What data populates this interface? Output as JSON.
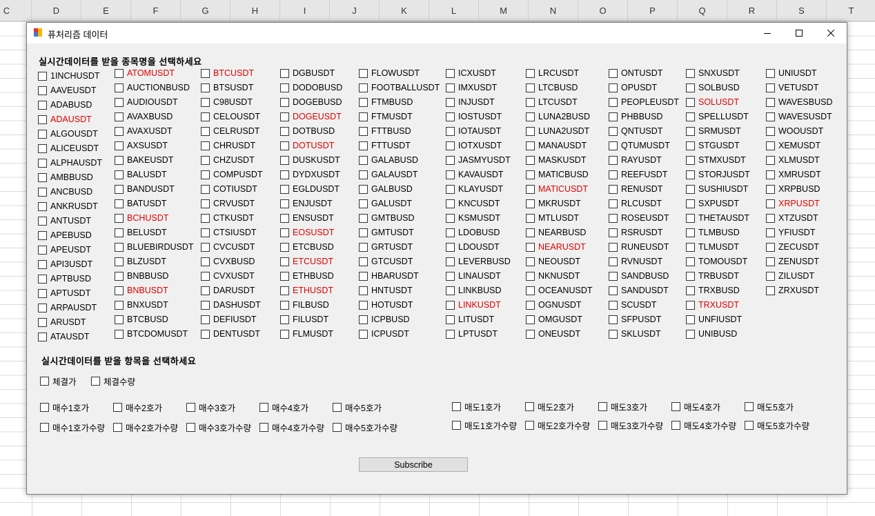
{
  "spreadsheet": {
    "columns": [
      "C",
      "D",
      "E",
      "F",
      "G",
      "H",
      "I",
      "J",
      "K",
      "L",
      "M",
      "N",
      "O",
      "P",
      "Q",
      "R",
      "S",
      "T"
    ]
  },
  "window": {
    "title": "퓨처리즘 데이터",
    "minimize_icon": "minimize-icon",
    "maximize_icon": "maximize-icon",
    "close_icon": "close-icon"
  },
  "symbols_heading": "실시간데이터를 받을 종목명을 선택하세요",
  "symbol_columns": [
    [
      {
        "label": "1INCHUSDT"
      },
      {
        "label": "AAVEUSDT"
      },
      {
        "label": "ADABUSD"
      },
      {
        "label": "ADAUSDT",
        "highlight": true
      },
      {
        "label": "ALGOUSDT"
      },
      {
        "label": "ALICEUSDT"
      },
      {
        "label": "ALPHAUSDT"
      },
      {
        "label": "AMBBUSD"
      },
      {
        "label": "ANCBUSD"
      },
      {
        "label": "ANKRUSDT"
      },
      {
        "label": "ANTUSDT"
      },
      {
        "label": "APEBUSD"
      },
      {
        "label": "APEUSDT"
      },
      {
        "label": "API3USDT"
      },
      {
        "label": "APTBUSD"
      },
      {
        "label": "APTUSDT"
      },
      {
        "label": "ARPAUSDT"
      },
      {
        "label": "ARUSDT"
      },
      {
        "label": "ATAUSDT"
      }
    ],
    [
      {
        "label": "ATOMUSDT",
        "highlight": true
      },
      {
        "label": "AUCTIONBUSD"
      },
      {
        "label": "AUDIOUSDT"
      },
      {
        "label": "AVAXBUSD"
      },
      {
        "label": "AVAXUSDT"
      },
      {
        "label": "AXSUSDT"
      },
      {
        "label": "BAKEUSDT"
      },
      {
        "label": "BALUSDT"
      },
      {
        "label": "BANDUSDT"
      },
      {
        "label": "BATUSDT"
      },
      {
        "label": "BCHUSDT",
        "highlight": true
      },
      {
        "label": "BELUSDT"
      },
      {
        "label": "BLUEBIRDUSDT"
      },
      {
        "label": "BLZUSDT"
      },
      {
        "label": "BNBBUSD"
      },
      {
        "label": "BNBUSDT",
        "highlight": true
      },
      {
        "label": "BNXUSDT"
      },
      {
        "label": "BTCBUSD"
      },
      {
        "label": "BTCDOMUSDT"
      }
    ],
    [
      {
        "label": "BTCUSDT",
        "highlight": true
      },
      {
        "label": "BTSUSDT"
      },
      {
        "label": "C98USDT"
      },
      {
        "label": "CELOUSDT"
      },
      {
        "label": "CELRUSDT"
      },
      {
        "label": "CHRUSDT"
      },
      {
        "label": "CHZUSDT"
      },
      {
        "label": "COMPUSDT"
      },
      {
        "label": "COTIUSDT"
      },
      {
        "label": "CRVUSDT"
      },
      {
        "label": "CTKUSDT"
      },
      {
        "label": "CTSIUSDT"
      },
      {
        "label": "CVCUSDT"
      },
      {
        "label": "CVXBUSD"
      },
      {
        "label": "CVXUSDT"
      },
      {
        "label": "DARUSDT"
      },
      {
        "label": "DASHUSDT"
      },
      {
        "label": "DEFIUSDT"
      },
      {
        "label": "DENTUSDT"
      }
    ],
    [
      {
        "label": "DGBUSDT"
      },
      {
        "label": "DODOBUSD"
      },
      {
        "label": "DOGEBUSD"
      },
      {
        "label": "DOGEUSDT",
        "highlight": true
      },
      {
        "label": "DOTBUSD"
      },
      {
        "label": "DOTUSDT",
        "highlight": true
      },
      {
        "label": "DUSKUSDT"
      },
      {
        "label": "DYDXUSDT"
      },
      {
        "label": "EGLDUSDT"
      },
      {
        "label": "ENJUSDT"
      },
      {
        "label": "ENSUSDT"
      },
      {
        "label": "EOSUSDT",
        "highlight": true
      },
      {
        "label": "ETCBUSD"
      },
      {
        "label": "ETCUSDT",
        "highlight": true
      },
      {
        "label": "ETHBUSD"
      },
      {
        "label": "ETHUSDT",
        "highlight": true
      },
      {
        "label": "FILBUSD"
      },
      {
        "label": "FILUSDT"
      },
      {
        "label": "FLMUSDT"
      }
    ],
    [
      {
        "label": "FLOWUSDT"
      },
      {
        "label": "FOOTBALLUSDT"
      },
      {
        "label": "FTMBUSD"
      },
      {
        "label": "FTMUSDT"
      },
      {
        "label": "FTTBUSD"
      },
      {
        "label": "FTTUSDT"
      },
      {
        "label": "GALABUSD"
      },
      {
        "label": "GALAUSDT"
      },
      {
        "label": "GALBUSD"
      },
      {
        "label": "GALUSDT"
      },
      {
        "label": "GMTBUSD"
      },
      {
        "label": "GMTUSDT"
      },
      {
        "label": "GRTUSDT"
      },
      {
        "label": "GTCUSDT"
      },
      {
        "label": "HBARUSDT"
      },
      {
        "label": "HNTUSDT"
      },
      {
        "label": "HOTUSDT"
      },
      {
        "label": "ICPBUSD"
      },
      {
        "label": "ICPUSDT"
      }
    ],
    [
      {
        "label": "ICXUSDT"
      },
      {
        "label": "IMXUSDT"
      },
      {
        "label": "INJUSDT"
      },
      {
        "label": "IOSTUSDT"
      },
      {
        "label": "IOTAUSDT"
      },
      {
        "label": "IOTXUSDT"
      },
      {
        "label": "JASMYUSDT"
      },
      {
        "label": "KAVAUSDT"
      },
      {
        "label": "KLAYUSDT"
      },
      {
        "label": "KNCUSDT"
      },
      {
        "label": "KSMUSDT"
      },
      {
        "label": "LDOBUSD"
      },
      {
        "label": "LDOUSDT"
      },
      {
        "label": "LEVERBUSD"
      },
      {
        "label": "LINAUSDT"
      },
      {
        "label": "LINKBUSD"
      },
      {
        "label": "LINKUSDT",
        "highlight": true
      },
      {
        "label": "LITUSDT"
      },
      {
        "label": "LPTUSDT"
      }
    ],
    [
      {
        "label": "LRCUSDT"
      },
      {
        "label": "LTCBUSD"
      },
      {
        "label": "LTCUSDT"
      },
      {
        "label": "LUNA2BUSD"
      },
      {
        "label": "LUNA2USDT"
      },
      {
        "label": "MANAUSDT"
      },
      {
        "label": "MASKUSDT"
      },
      {
        "label": "MATICBUSD"
      },
      {
        "label": "MATICUSDT",
        "highlight": true
      },
      {
        "label": "MKRUSDT"
      },
      {
        "label": "MTLUSDT"
      },
      {
        "label": "NEARBUSD"
      },
      {
        "label": "NEARUSDT",
        "highlight": true
      },
      {
        "label": "NEOUSDT"
      },
      {
        "label": "NKNUSDT"
      },
      {
        "label": "OCEANUSDT"
      },
      {
        "label": "OGNUSDT"
      },
      {
        "label": "OMGUSDT"
      },
      {
        "label": "ONEUSDT"
      }
    ],
    [
      {
        "label": "ONTUSDT"
      },
      {
        "label": "OPUSDT"
      },
      {
        "label": "PEOPLEUSDT"
      },
      {
        "label": "PHBBUSD"
      },
      {
        "label": "QNTUSDT"
      },
      {
        "label": "QTUMUSDT"
      },
      {
        "label": "RAYUSDT"
      },
      {
        "label": "REEFUSDT"
      },
      {
        "label": "RENUSDT"
      },
      {
        "label": "RLCUSDT"
      },
      {
        "label": "ROSEUSDT"
      },
      {
        "label": "RSRUSDT"
      },
      {
        "label": "RUNEUSDT"
      },
      {
        "label": "RVNUSDT"
      },
      {
        "label": "SANDBUSD"
      },
      {
        "label": "SANDUSDT"
      },
      {
        "label": "SCUSDT"
      },
      {
        "label": "SFPUSDT"
      },
      {
        "label": "SKLUSDT"
      }
    ],
    [
      {
        "label": "SNXUSDT"
      },
      {
        "label": "SOLBUSD"
      },
      {
        "label": "SOLUSDT",
        "highlight": true
      },
      {
        "label": "SPELLUSDT"
      },
      {
        "label": "SRMUSDT"
      },
      {
        "label": "STGUSDT"
      },
      {
        "label": "STMXUSDT"
      },
      {
        "label": "STORJUSDT"
      },
      {
        "label": "SUSHIUSDT"
      },
      {
        "label": "SXPUSDT"
      },
      {
        "label": "THETAUSDT"
      },
      {
        "label": "TLMBUSD"
      },
      {
        "label": "TLMUSDT"
      },
      {
        "label": "TOMOUSDT"
      },
      {
        "label": "TRBUSDT"
      },
      {
        "label": "TRXBUSD"
      },
      {
        "label": "TRXUSDT",
        "highlight": true
      },
      {
        "label": "UNFIUSDT"
      },
      {
        "label": "UNIBUSD"
      }
    ],
    [
      {
        "label": "UNIUSDT"
      },
      {
        "label": "VETUSDT"
      },
      {
        "label": "WAVESBUSD"
      },
      {
        "label": "WAVESUSDT"
      },
      {
        "label": "WOOUSDT"
      },
      {
        "label": "XEMUSDT"
      },
      {
        "label": "XLMUSDT"
      },
      {
        "label": "XMRUSDT"
      },
      {
        "label": "XRPBUSD"
      },
      {
        "label": "XRPUSDT",
        "highlight": true
      },
      {
        "label": "XTZUSDT"
      },
      {
        "label": "YFIUSDT"
      },
      {
        "label": "ZECUSDT"
      },
      {
        "label": "ZENUSDT"
      },
      {
        "label": "ZILUSDT"
      },
      {
        "label": "ZRXUSDT"
      }
    ]
  ],
  "highlight_color": "#e00000",
  "fields_heading": "실시간데이터를 받을 항목을 선택하세요",
  "trade_fields": [
    "체결가",
    "체결수량"
  ],
  "bid_prices": [
    "매수1호가",
    "매수2호가",
    "매수3호가",
    "매수4호가",
    "매수5호가"
  ],
  "bid_quantities": [
    "매수1호가수량",
    "매수2호가수량",
    "매수3호가수량",
    "매수4호가수량",
    "매수5호가수량"
  ],
  "ask_prices": [
    "매도1호가",
    "매도2호가",
    "매도3호가",
    "매도4호가",
    "매도5호가"
  ],
  "ask_quantities": [
    "매도1호가수량",
    "매도2호가수량",
    "매도3호가수량",
    "매도4호가수량",
    "매도5호가수량"
  ],
  "subscribe_label": "Subscribe"
}
